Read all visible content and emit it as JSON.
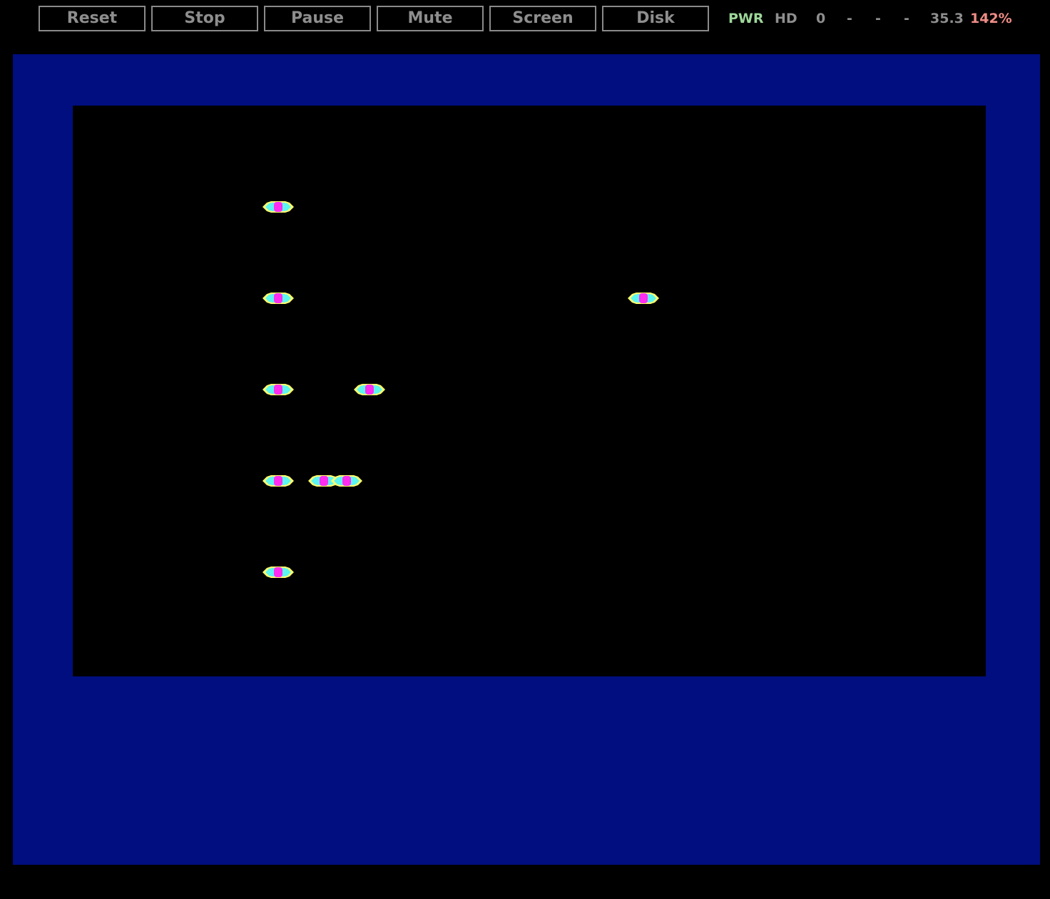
{
  "toolbar": {
    "buttons": [
      {
        "label": "Reset"
      },
      {
        "label": "Stop"
      },
      {
        "label": "Pause"
      },
      {
        "label": "Mute"
      },
      {
        "label": "Screen"
      },
      {
        "label": "Disk"
      }
    ]
  },
  "status": {
    "power": "PWR",
    "drive": "HD",
    "d0": "0",
    "d1": "-",
    "d2": "-",
    "d3": "-",
    "mhz": "35.3",
    "speed": "142%"
  },
  "colors": {
    "border": "#000e80",
    "screen": "#000000",
    "button_text": "#8e8e8e",
    "pwr": "#9ed79a",
    "speed": "#ee8c86",
    "pod_body": "#5cf5f0",
    "pod_edge": "#ffff6e",
    "pod_core": "#ff2eef"
  },
  "game": {
    "sprites": [
      {
        "name": "centipede-segment",
        "count": 1
      },
      {
        "name": "centipede-segment",
        "count": 1
      },
      {
        "name": "centipede-segment",
        "count": 1
      },
      {
        "name": "centipede-segment",
        "count": 1
      },
      {
        "name": "centipede-segment",
        "count": 1
      },
      {
        "name": "centipede-segment",
        "count": 1
      },
      {
        "name": "centipede-segment",
        "count": 1
      },
      {
        "name": "centipede-segment",
        "count": 2
      }
    ]
  }
}
